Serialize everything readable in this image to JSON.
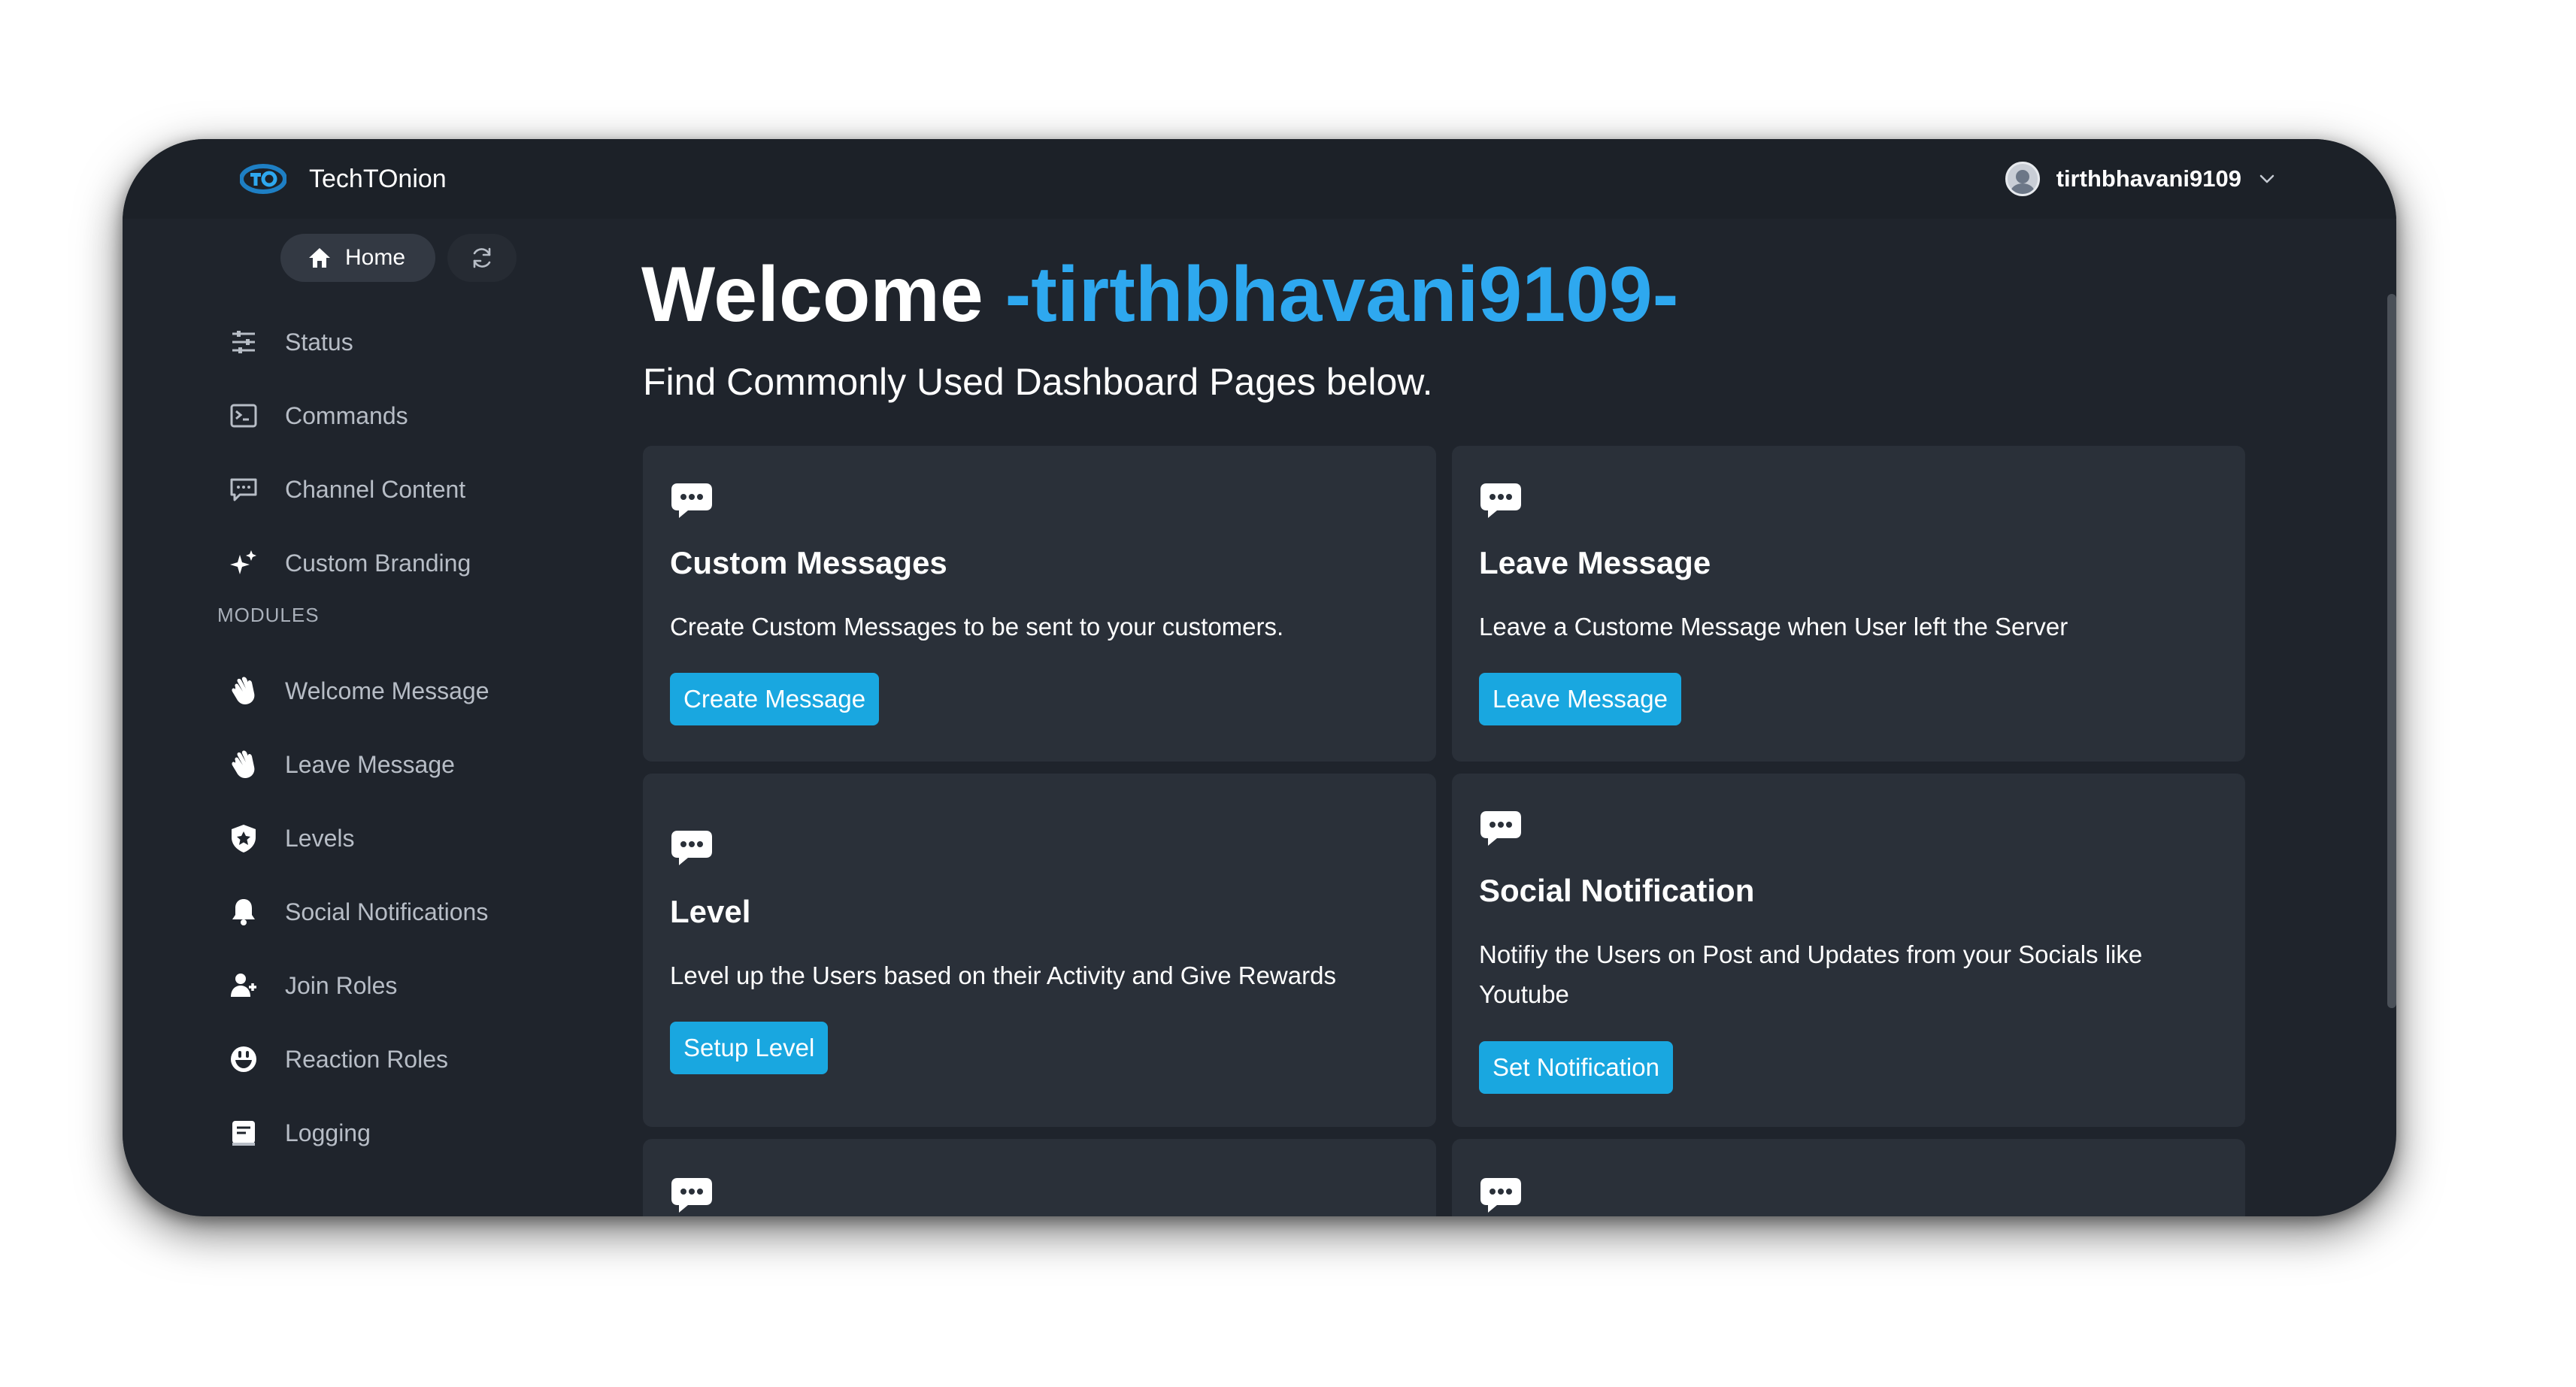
{
  "app": {
    "brand": "TechTOnion"
  },
  "user": {
    "name": "tirthbhavani9109"
  },
  "sidebar": {
    "home_label": "Home",
    "items": [
      {
        "label": "Status",
        "icon": "sliders-icon"
      },
      {
        "label": "Commands",
        "icon": "terminal-icon"
      },
      {
        "label": "Channel Content",
        "icon": "chat-icon"
      },
      {
        "label": "Custom Branding",
        "icon": "sparkles-icon"
      }
    ],
    "section_label": "MODULES",
    "modules": [
      {
        "label": "Welcome Message",
        "icon": "wave-hand-icon"
      },
      {
        "label": "Leave Message",
        "icon": "wave-hand-icon"
      },
      {
        "label": "Levels",
        "icon": "shield-icon"
      },
      {
        "label": "Social Notifications",
        "icon": "bell-icon"
      },
      {
        "label": "Join Roles",
        "icon": "user-add-icon"
      },
      {
        "label": "Reaction Roles",
        "icon": "smiley-icon"
      },
      {
        "label": "Logging",
        "icon": "log-icon"
      }
    ]
  },
  "main": {
    "welcome_prefix": "Welcome",
    "welcome_name": "-tirthbhavani9109-",
    "subtitle": "Find Commonly Used Dashboard Pages below.",
    "cards": [
      {
        "title": "Custom Messages",
        "desc": "Create Custom Messages to be sent to your customers.",
        "button": "Create Message"
      },
      {
        "title": "Leave Message",
        "desc": "Leave a Custome Message when User left the Server",
        "button": "Leave Message"
      },
      {
        "title": "Level",
        "desc": "Level up the Users based on their Activity and Give Rewards",
        "button": "Setup Level"
      },
      {
        "title": "Social Notification",
        "desc": "Notifiy the Users on Post and Updates from your Socials like Youtube",
        "button": "Set Notification"
      }
    ]
  },
  "colors": {
    "accent": "#2ea8ef",
    "button": "#19a7e0",
    "card": "#2a3039",
    "background": "#1f242c"
  }
}
